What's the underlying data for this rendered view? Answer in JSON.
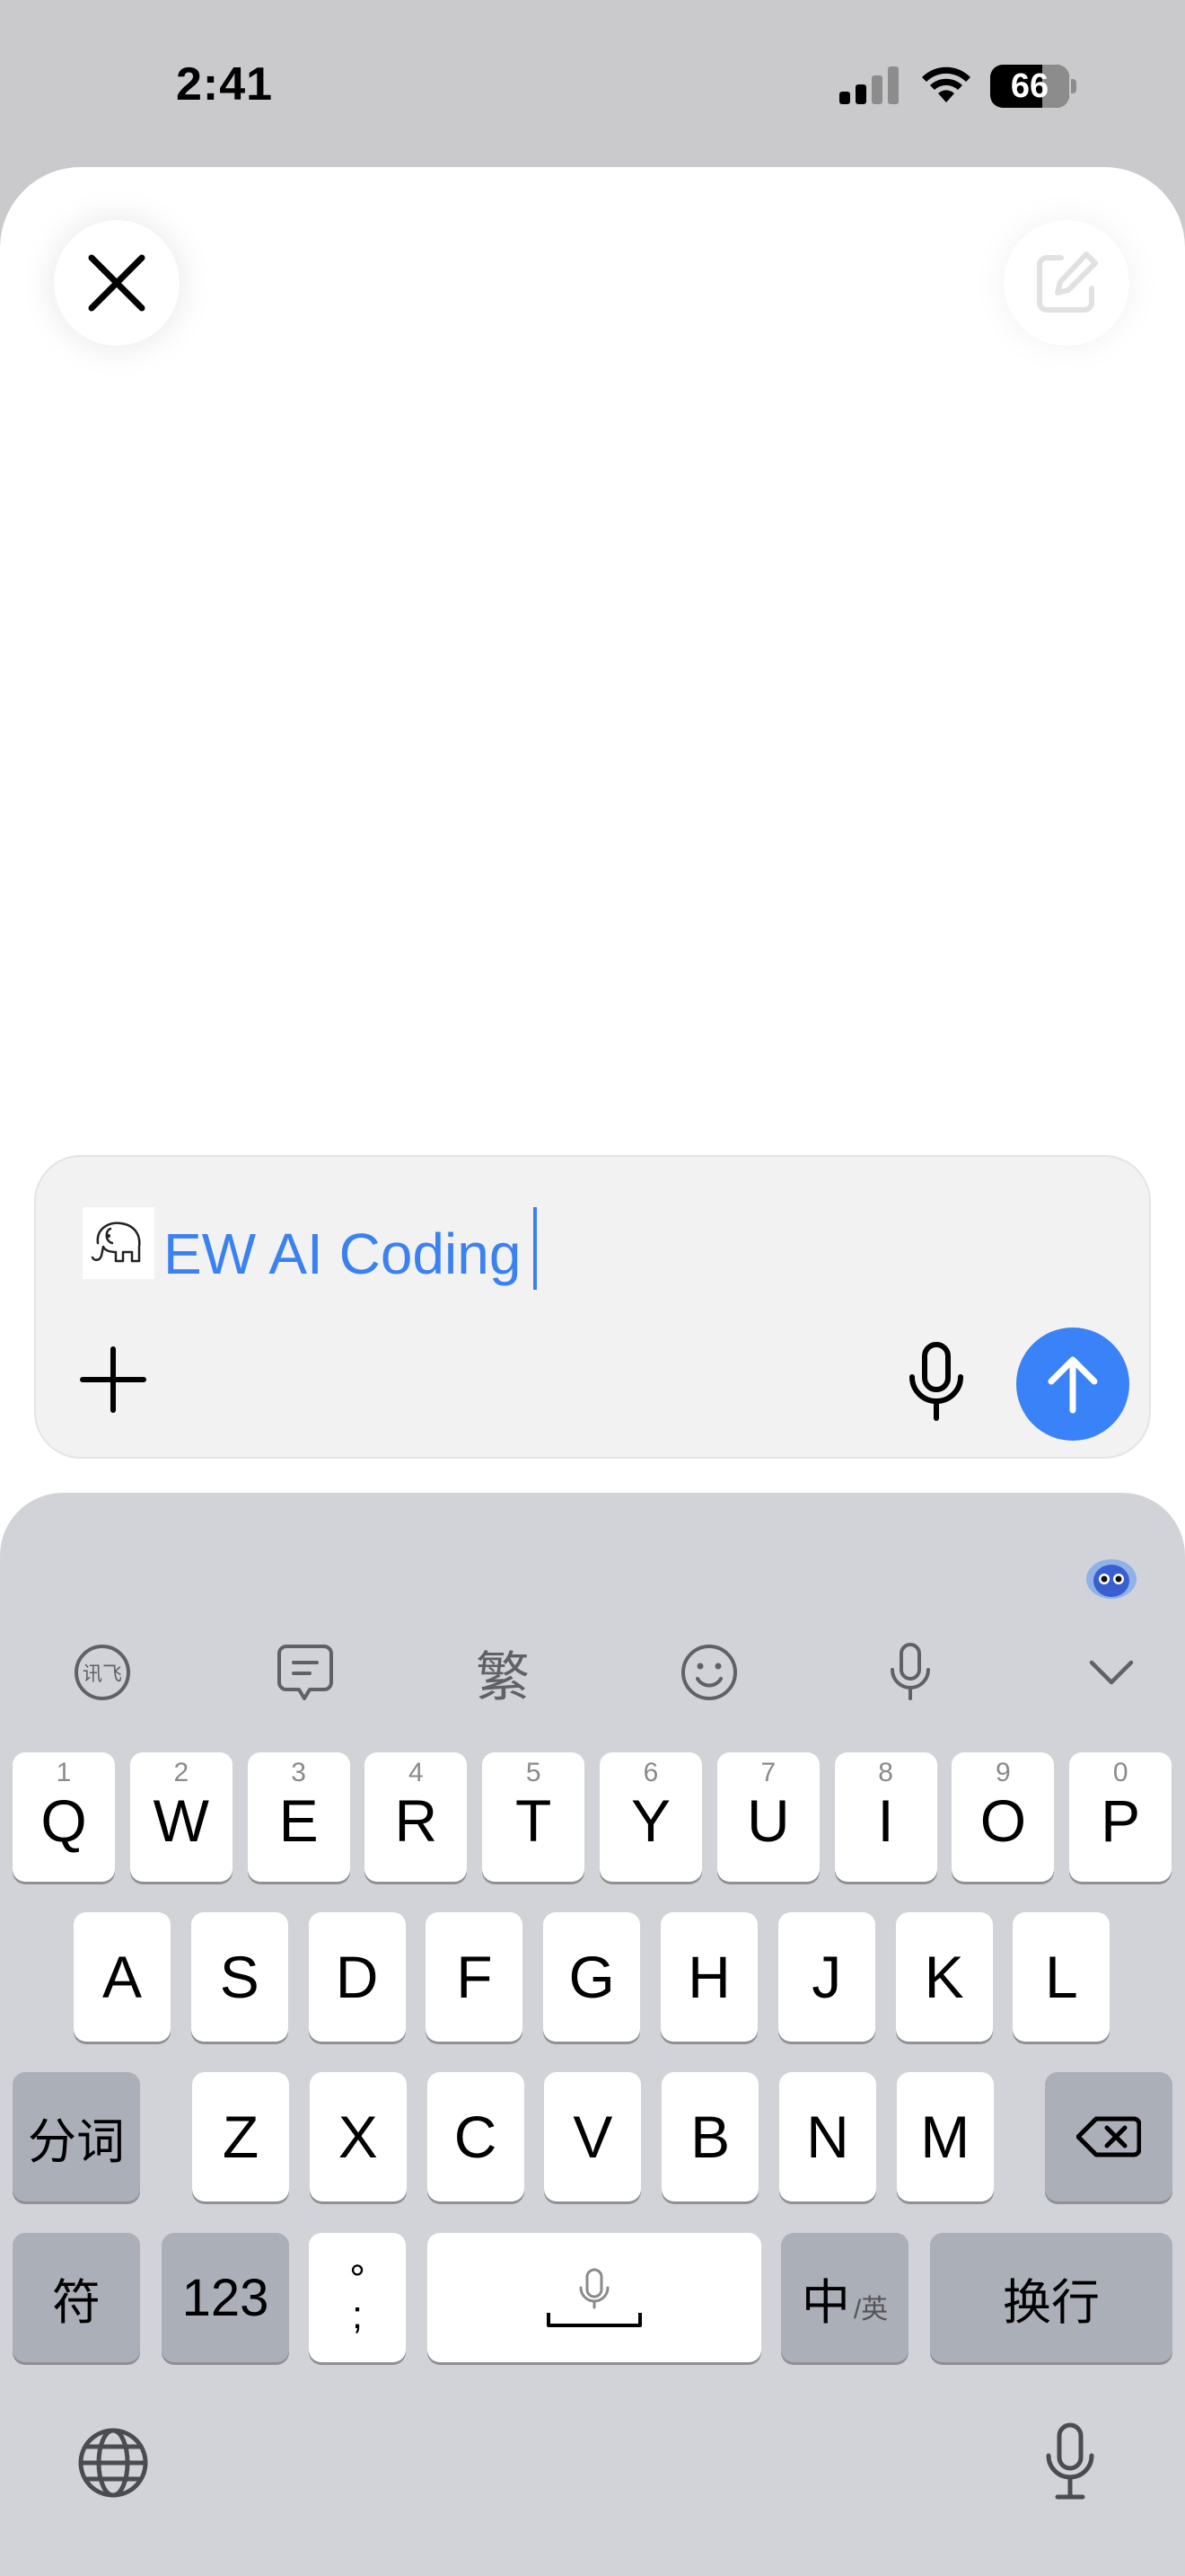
{
  "status": {
    "time": "2:41",
    "battery": "66"
  },
  "sheet": {
    "close_icon": "close-icon",
    "edit_icon": "compose-icon"
  },
  "composer": {
    "tag_icon": "elephant-logo-icon",
    "input_value": "EW AI Coding",
    "attach_icon": "plus-icon",
    "mic_icon": "mic-icon",
    "send_icon": "arrow-up-icon",
    "accent": "#3a82f7"
  },
  "keyboard": {
    "toolbar": [
      "ifly-logo-icon",
      "message-icon",
      "traditional-chinese-icon",
      "emoji-icon",
      "mic-icon",
      "chevron-down-icon"
    ],
    "traditional_label": "繁",
    "ifly_label": "讯飞",
    "row1": [
      {
        "n": "1",
        "k": "Q"
      },
      {
        "n": "2",
        "k": "W"
      },
      {
        "n": "3",
        "k": "E"
      },
      {
        "n": "4",
        "k": "R"
      },
      {
        "n": "5",
        "k": "T"
      },
      {
        "n": "6",
        "k": "Y"
      },
      {
        "n": "7",
        "k": "U"
      },
      {
        "n": "8",
        "k": "I"
      },
      {
        "n": "9",
        "k": "O"
      },
      {
        "n": "0",
        "k": "P"
      }
    ],
    "row2": [
      "A",
      "S",
      "D",
      "F",
      "G",
      "H",
      "J",
      "K",
      "L"
    ],
    "row3": [
      "Z",
      "X",
      "C",
      "V",
      "B",
      "N",
      "M"
    ],
    "segment_key": "分词",
    "symbol_key": "符",
    "num_key": "123",
    "punct_top": "°",
    "punct_bottom": ";",
    "lang_key_main": "中",
    "lang_key_sub": "/英",
    "return_key": "换行",
    "globe_icon": "globe-icon",
    "dictation_icon": "mic-icon"
  }
}
